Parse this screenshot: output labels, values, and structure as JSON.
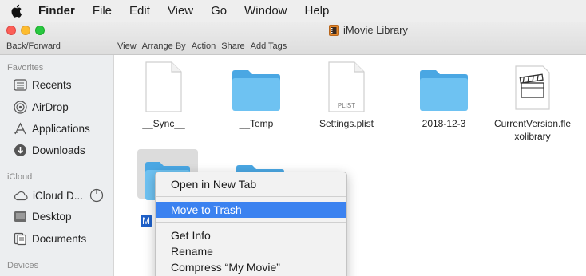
{
  "menubar": {
    "apple_icon": "apple-logo",
    "items": [
      "Finder",
      "File",
      "Edit",
      "View",
      "Go",
      "Window",
      "Help"
    ]
  },
  "window": {
    "title": "iMovie Library",
    "nav_label": "Back/Forward",
    "toolbar_actions": [
      "View",
      "Arrange By",
      "Action",
      "Share",
      "Add Tags"
    ]
  },
  "sidebar": {
    "favorites_heading": "Favorites",
    "favorites": [
      {
        "label": "Recents",
        "icon": "recents-icon"
      },
      {
        "label": "AirDrop",
        "icon": "airdrop-icon"
      },
      {
        "label": "Applications",
        "icon": "applications-icon"
      },
      {
        "label": "Downloads",
        "icon": "downloads-icon"
      }
    ],
    "icloud_heading": "iCloud",
    "icloud": [
      {
        "label": "iCloud D...",
        "icon": "cloud-icon"
      },
      {
        "label": "Desktop",
        "icon": "desktop-icon"
      },
      {
        "label": "Documents",
        "icon": "documents-icon"
      }
    ],
    "devices_heading": "Devices"
  },
  "files": [
    {
      "name": "__Sync__",
      "kind": "document"
    },
    {
      "name": "__Temp",
      "kind": "folder"
    },
    {
      "name": "Settings.plist",
      "kind": "plist",
      "badge": "PLIST"
    },
    {
      "name": "2018-12-3",
      "kind": "folder"
    },
    {
      "name": "CurrentVersion.fle\nxolibrary",
      "kind": "library"
    }
  ],
  "selected_item_label": "M",
  "context_menu": {
    "items": [
      "Open in New Tab",
      "Move to Trash",
      "Get Info",
      "Rename",
      "Compress “My Movie”"
    ],
    "highlighted": "Move to Trash"
  },
  "colors": {
    "folder": "#5fb9ee",
    "highlight": "#3b82f0",
    "selection": "#1e60c8"
  }
}
